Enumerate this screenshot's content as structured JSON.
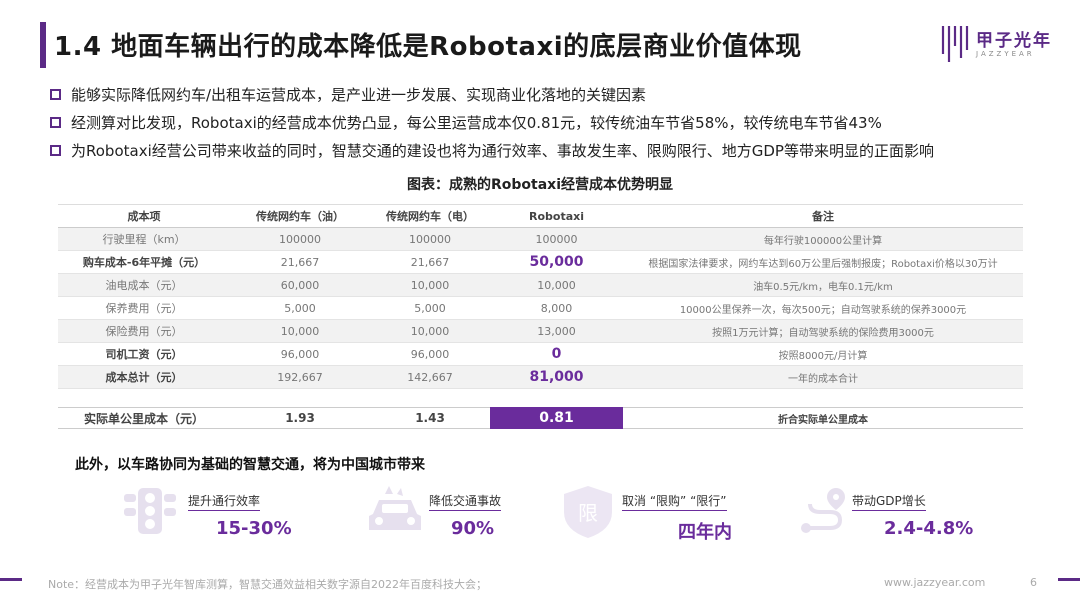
{
  "title": "1.4 地面车辆出行的成本降低是Robotaxi的底层商业价值体现",
  "logo": {
    "name": "甲子光年",
    "sub": "JAZZYEAR"
  },
  "bullets": [
    "能够实际降低网约车/出租车运营成本，是产业进一步发展、实现商业化落地的关键因素",
    "经测算对比发现，Robotaxi的经营成本优势凸显，每公里运营成本仅0.81元，较传统油车节省58%，较传统电车节省43%",
    "为Robotaxi经营公司带来收益的同时，智慧交通的建设也将为通行效率、事故发生率、限购限行、地方GDP等带来明显的正面影响"
  ],
  "table": {
    "caption": "图表：成熟的Robotaxi经营成本优势明显",
    "headers": [
      "成本项",
      "传统网约车（油）",
      "传统网约车（电）",
      "Robotaxi",
      "备注"
    ],
    "rows": [
      [
        "行驶里程（km）",
        "100000",
        "100000",
        "100000",
        "每年行驶100000公里计算"
      ],
      [
        "购车成本-6年平摊（元）",
        "21,667",
        "21,667",
        "50,000",
        "根据国家法律要求，网约车达到60万公里后强制报废；Robotaxi价格以30万计"
      ],
      [
        "油电成本（元）",
        "60,000",
        "10,000",
        "10,000",
        "油车0.5元/km，电车0.1元/km"
      ],
      [
        "保养费用（元）",
        "5,000",
        "5,000",
        "8,000",
        "10000公里保养一次，每次500元；自动驾驶系统的保养3000元"
      ],
      [
        "保险费用（元）",
        "10,000",
        "10,000",
        "13,000",
        "按照1万元计算；自动驾驶系统的保险费用3000元"
      ],
      [
        "司机工资（元）",
        "96,000",
        "96,000",
        "0",
        "按照8000元/月计算"
      ],
      [
        "成本总计（元）",
        "192,667",
        "142,667",
        "81,000",
        "一年的成本合计"
      ]
    ],
    "summary": [
      "实际单公里成本（元）",
      "1.93",
      "1.43",
      "0.81",
      "折合实际单公里成本"
    ]
  },
  "section_head": "此外，以车路协同为基础的智慧交通，将为中国城市带来",
  "kpis": [
    {
      "label": "提升通行效率",
      "value": "15-30%",
      "icon": "traffic-light-icon"
    },
    {
      "label": "降低交通事故",
      "value": "90%",
      "icon": "car-crash-icon"
    },
    {
      "label": "取消 “限购” “限行”",
      "value": "四年内",
      "icon": "restriction-shield-icon"
    },
    {
      "label": "带动GDP增长",
      "value": "2.4-4.8%",
      "icon": "route-map-icon"
    }
  ],
  "footer": {
    "note": "Note：经营成本为甲子光年智库测算，智慧交通效益相关数字源自2022年百度科技大会；",
    "url": "www.jazzyear.com",
    "page": "6"
  },
  "colors": {
    "accent": "#6a2c9c",
    "brand": "#5b2a86"
  }
}
